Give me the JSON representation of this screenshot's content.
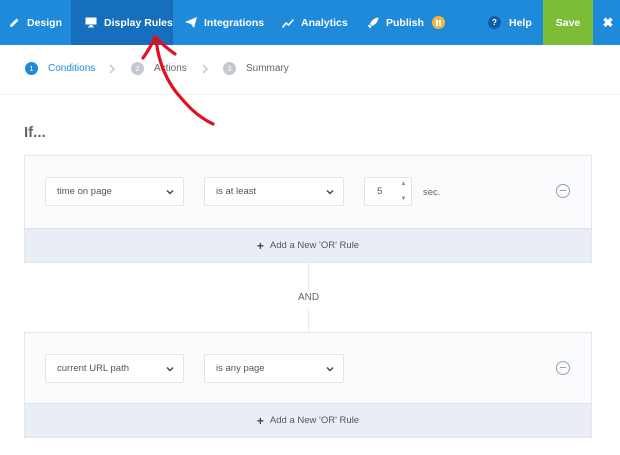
{
  "nav": {
    "items": [
      {
        "label": "Design",
        "icon": "pencil-icon"
      },
      {
        "label": "Display Rules",
        "icon": "monitor-icon",
        "active": true
      },
      {
        "label": "Integrations",
        "icon": "paper-plane-icon"
      },
      {
        "label": "Analytics",
        "icon": "line-chart-icon"
      },
      {
        "label": "Publish",
        "icon": "rocket-icon",
        "badge": "pause-icon"
      }
    ],
    "help_label": "Help",
    "help_glyph": "?",
    "save_label": "Save",
    "close_glyph": "✖",
    "colors": {
      "bar": "#1f8ad9",
      "active": "#156fbd",
      "save": "#7bbd37",
      "badge": "#f5b73b"
    }
  },
  "steps": [
    {
      "num": "1",
      "label": "Conditions",
      "active": true
    },
    {
      "num": "2",
      "label": "Actions",
      "active": false
    },
    {
      "num": "3",
      "label": "Summary",
      "active": false
    }
  ],
  "main": {
    "title": "If...",
    "and_label": "AND",
    "add_or_rule_label": "Add a New 'OR' Rule",
    "add_glyph": "+",
    "rules": [
      {
        "field": "time on page",
        "operator": "is at least",
        "value": "5",
        "unit": "sec."
      },
      {
        "field": "current URL path",
        "operator": "is any page"
      }
    ]
  },
  "annotation": {
    "color": "#e0101e",
    "shape": "hand-drawn-arrow"
  }
}
